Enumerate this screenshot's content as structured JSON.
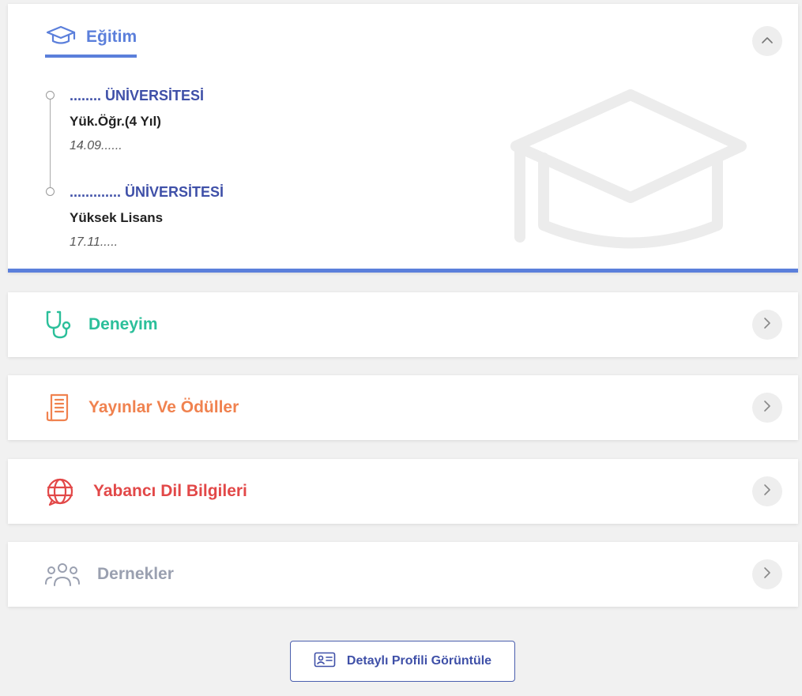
{
  "education": {
    "title": "Eğitim",
    "items": [
      {
        "university": "........ ÜNİVERSİTESİ",
        "degree": "Yük.Öğr.(4 Yıl)",
        "date": "14.09......"
      },
      {
        "university": "............. ÜNİVERSİTESİ",
        "degree": "Yüksek Lisans",
        "date": "17.11....."
      }
    ]
  },
  "sections": [
    {
      "title": "Deneyim",
      "icon": "stethoscope-icon",
      "color": "#2bbf9a"
    },
    {
      "title": "Yayınlar Ve Ödüller",
      "icon": "document-icon",
      "color": "#f0824f"
    },
    {
      "title": "Yabancı Dil Bilgileri",
      "icon": "globe-icon",
      "color": "#e24848"
    },
    {
      "title": "Dernekler",
      "icon": "people-icon",
      "color": "#9aa0b0"
    }
  ],
  "profile_button": {
    "label": "Detaylı Profili Görüntüle"
  },
  "colors": {
    "accent": "#5b7fdb",
    "navy": "#3f50a8",
    "background": "#f1f1f1"
  }
}
